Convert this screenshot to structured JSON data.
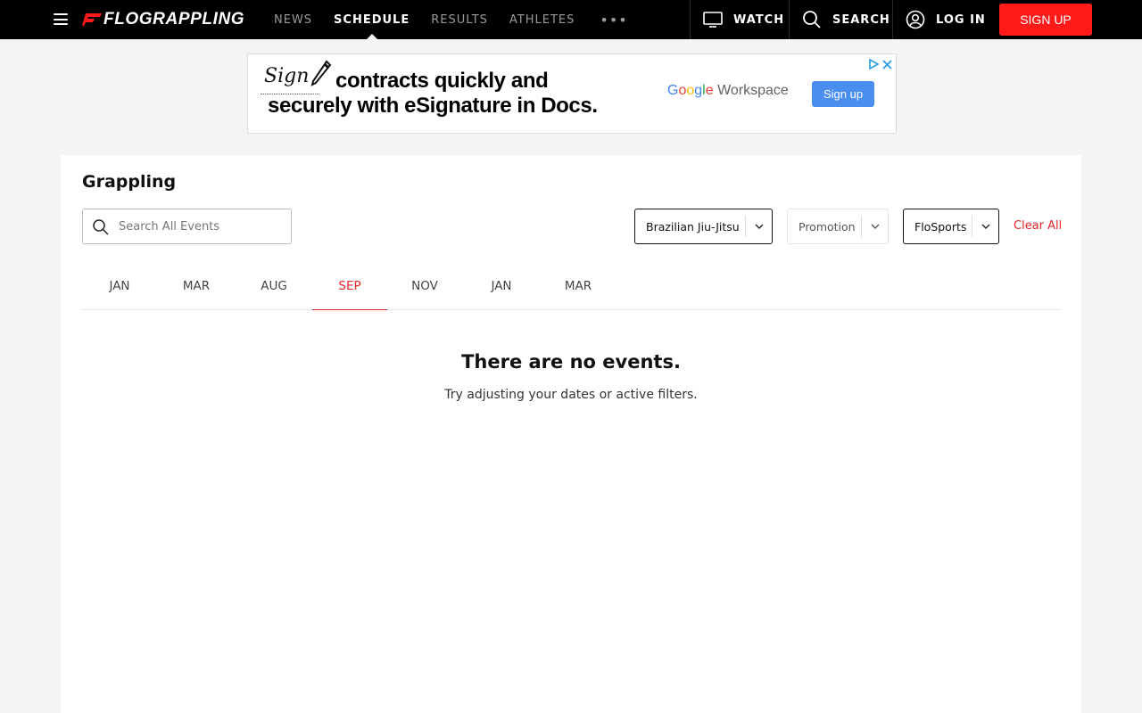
{
  "nav": {
    "logo_prefix": "FLO",
    "logo_suffix": "GRAPPLING",
    "links": [
      {
        "label": "NEWS",
        "active": false
      },
      {
        "label": "SCHEDULE",
        "active": true
      },
      {
        "label": "RESULTS",
        "active": false
      },
      {
        "label": "ATHLETES",
        "active": false
      }
    ],
    "more_label": "•••",
    "watch_label": "WATCH",
    "search_label": "SEARCH",
    "login_label": "LOG IN",
    "signup_label": "SIGN UP",
    "icons": {
      "menu": "hamburger-menu-icon",
      "watch": "monitor-icon",
      "search": "search-icon",
      "login": "user-circle-icon"
    }
  },
  "ad": {
    "sign_word": "Sign",
    "headline_line1": "contracts quickly and",
    "headline_line2": "securely with eSignature in Docs.",
    "brand_google": [
      "G",
      "o",
      "o",
      "g",
      "l",
      "e"
    ],
    "brand_product": "Workspace",
    "cta": "Sign up"
  },
  "main": {
    "title": "Grappling",
    "search": {
      "placeholder": "Search All Events",
      "value": ""
    },
    "filters": {
      "sport": "Brazilian Jiu-Jitsu",
      "promotion": "Promotion",
      "network": "FloSports",
      "clear_all": "Clear All"
    },
    "months": [
      {
        "label": "JAN",
        "active": false
      },
      {
        "label": "MAR",
        "active": false
      },
      {
        "label": "AUG",
        "active": false
      },
      {
        "label": "SEP",
        "active": true
      },
      {
        "label": "NOV",
        "active": false
      },
      {
        "label": "JAN",
        "active": false
      },
      {
        "label": "MAR",
        "active": false
      }
    ],
    "empty_title": "There are no events.",
    "empty_subtitle": "Try adjusting your dates or active filters."
  },
  "colors": {
    "nav_bg": "#000000",
    "accent_red": "#ff1a1a",
    "link_red": "#e5262b",
    "page_bg": "#f3f4f6"
  }
}
